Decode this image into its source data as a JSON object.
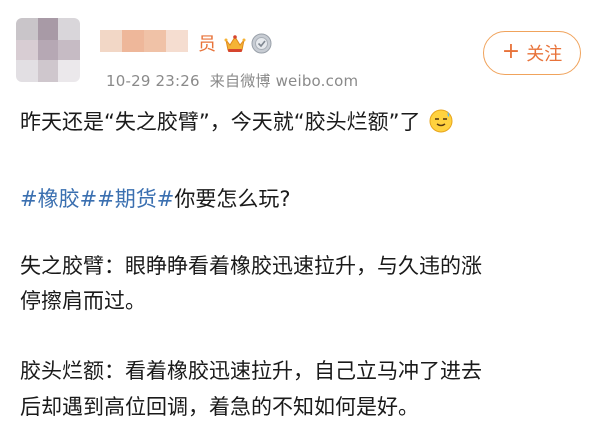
{
  "post": {
    "author_suffix": "员",
    "timestamp": "10-29 23:26",
    "source": "来自微博 weibo.com",
    "follow_label": "关注",
    "follow_plus": "+",
    "line1": "昨天还是“失之胶臂”，今天就“胶头烂额”了",
    "hashtag_rubber": "#橡胶#",
    "hashtag_futures": "#期货#",
    "line2_rest": "你要怎么玩?",
    "line3a": "失之胶臂：眼睁睁看着橡胶迅速拉升，与久违的涨",
    "line3b": "停擦肩而过。",
    "line4a": "胶头烂额：看着橡胶迅速拉升，自己立马冲了进去",
    "line4b": "后却遇到高位回调，着急的不知如何是好。"
  },
  "icons": {
    "avatar": "pixelated-avatar",
    "badge1": "crown-icon",
    "badge2": "medal-icon",
    "emoji": "sweat-smile-emoji-icon"
  },
  "colors": {
    "accent": "#e8733a",
    "hashtag": "#3a6fb0",
    "meta": "#8a8a8a"
  }
}
